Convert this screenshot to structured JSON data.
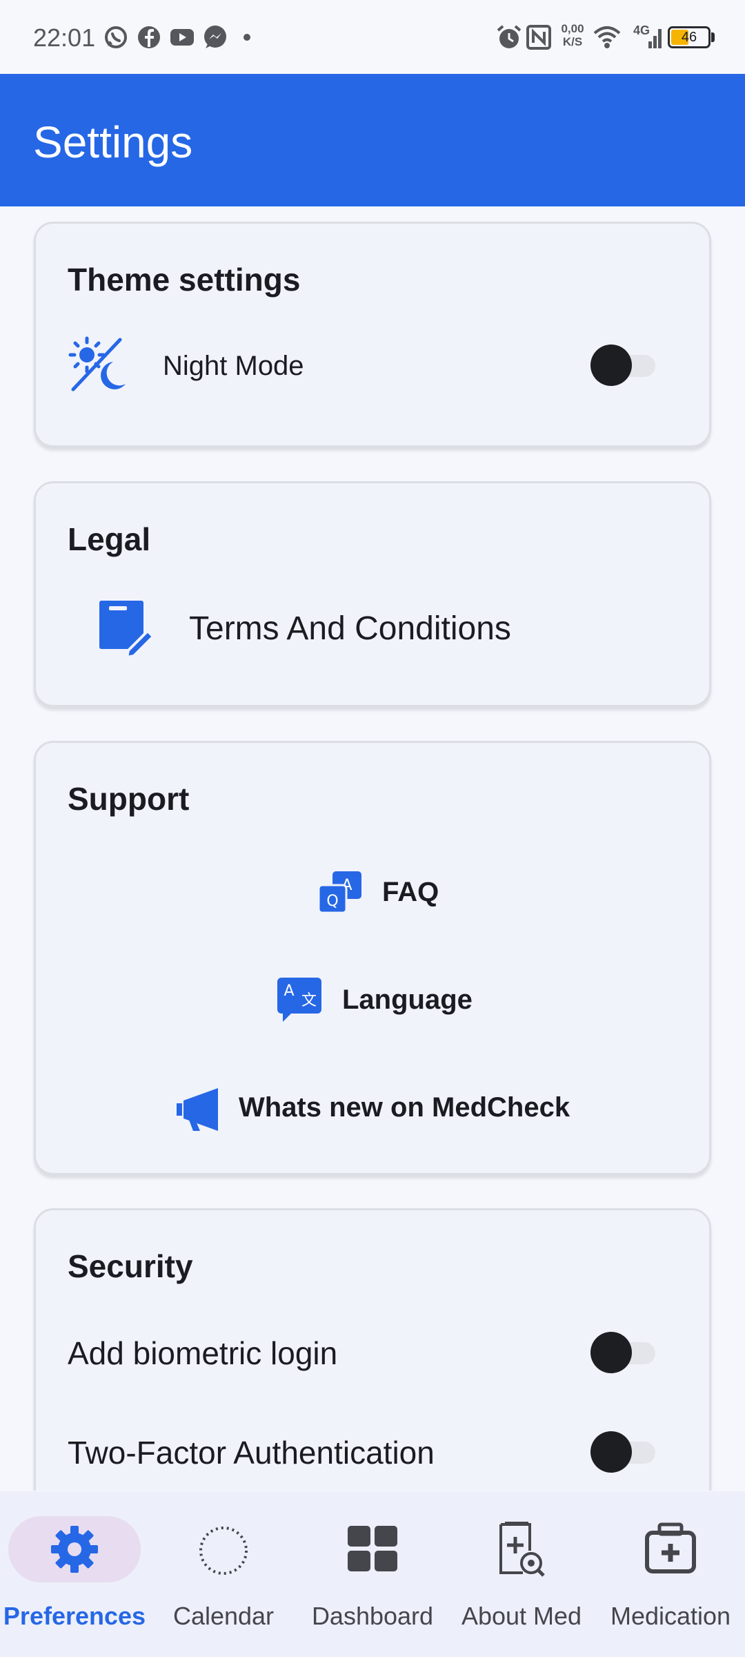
{
  "status_bar": {
    "time": "22:01",
    "network_speed_value": "0,00",
    "network_speed_unit": "K/S",
    "network_type": "4G",
    "battery_level": "46",
    "notification_icons": [
      "whatsapp-icon",
      "facebook-icon",
      "youtube-icon",
      "messenger-icon",
      "dot-icon"
    ],
    "system_icons": [
      "alarm-icon",
      "nfc-icon",
      "wifi-icon",
      "signal-icon",
      "battery-icon"
    ]
  },
  "app_bar": {
    "title": "Settings"
  },
  "theme_settings": {
    "title": "Theme settings",
    "night_mode": {
      "label": "Night Mode",
      "icon": "day-night-icon",
      "enabled": false
    }
  },
  "legal": {
    "title": "Legal",
    "terms": {
      "label": "Terms And Conditions",
      "icon": "document-edit-icon"
    }
  },
  "support": {
    "title": "Support",
    "faq": {
      "label": "FAQ",
      "icon": "faq-icon"
    },
    "language": {
      "label": "Language",
      "icon": "translate-icon"
    },
    "whats_new": {
      "label": "Whats new on MedCheck",
      "icon": "megaphone-icon"
    }
  },
  "security": {
    "title": "Security",
    "biometric": {
      "label": "Add biometric login",
      "enabled": false
    },
    "two_factor": {
      "label": "Two-Factor Authentication",
      "enabled": false
    }
  },
  "bottom_nav": {
    "active": "Preferences",
    "items": [
      {
        "label": "Preferences",
        "icon": "gear-icon"
      },
      {
        "label": "Calendar",
        "icon": "dotted-circle-icon"
      },
      {
        "label": "Dashboard",
        "icon": "dashboard-grid-icon"
      },
      {
        "label": "About Med",
        "icon": "medicine-search-icon"
      },
      {
        "label": "Medication",
        "icon": "medical-kit-icon"
      }
    ]
  },
  "colors": {
    "primary": "#2667e6",
    "card_background": "#f1f3fb",
    "toggle_thumb": "#1d1e22",
    "active_pill": "#e8dcf0"
  }
}
